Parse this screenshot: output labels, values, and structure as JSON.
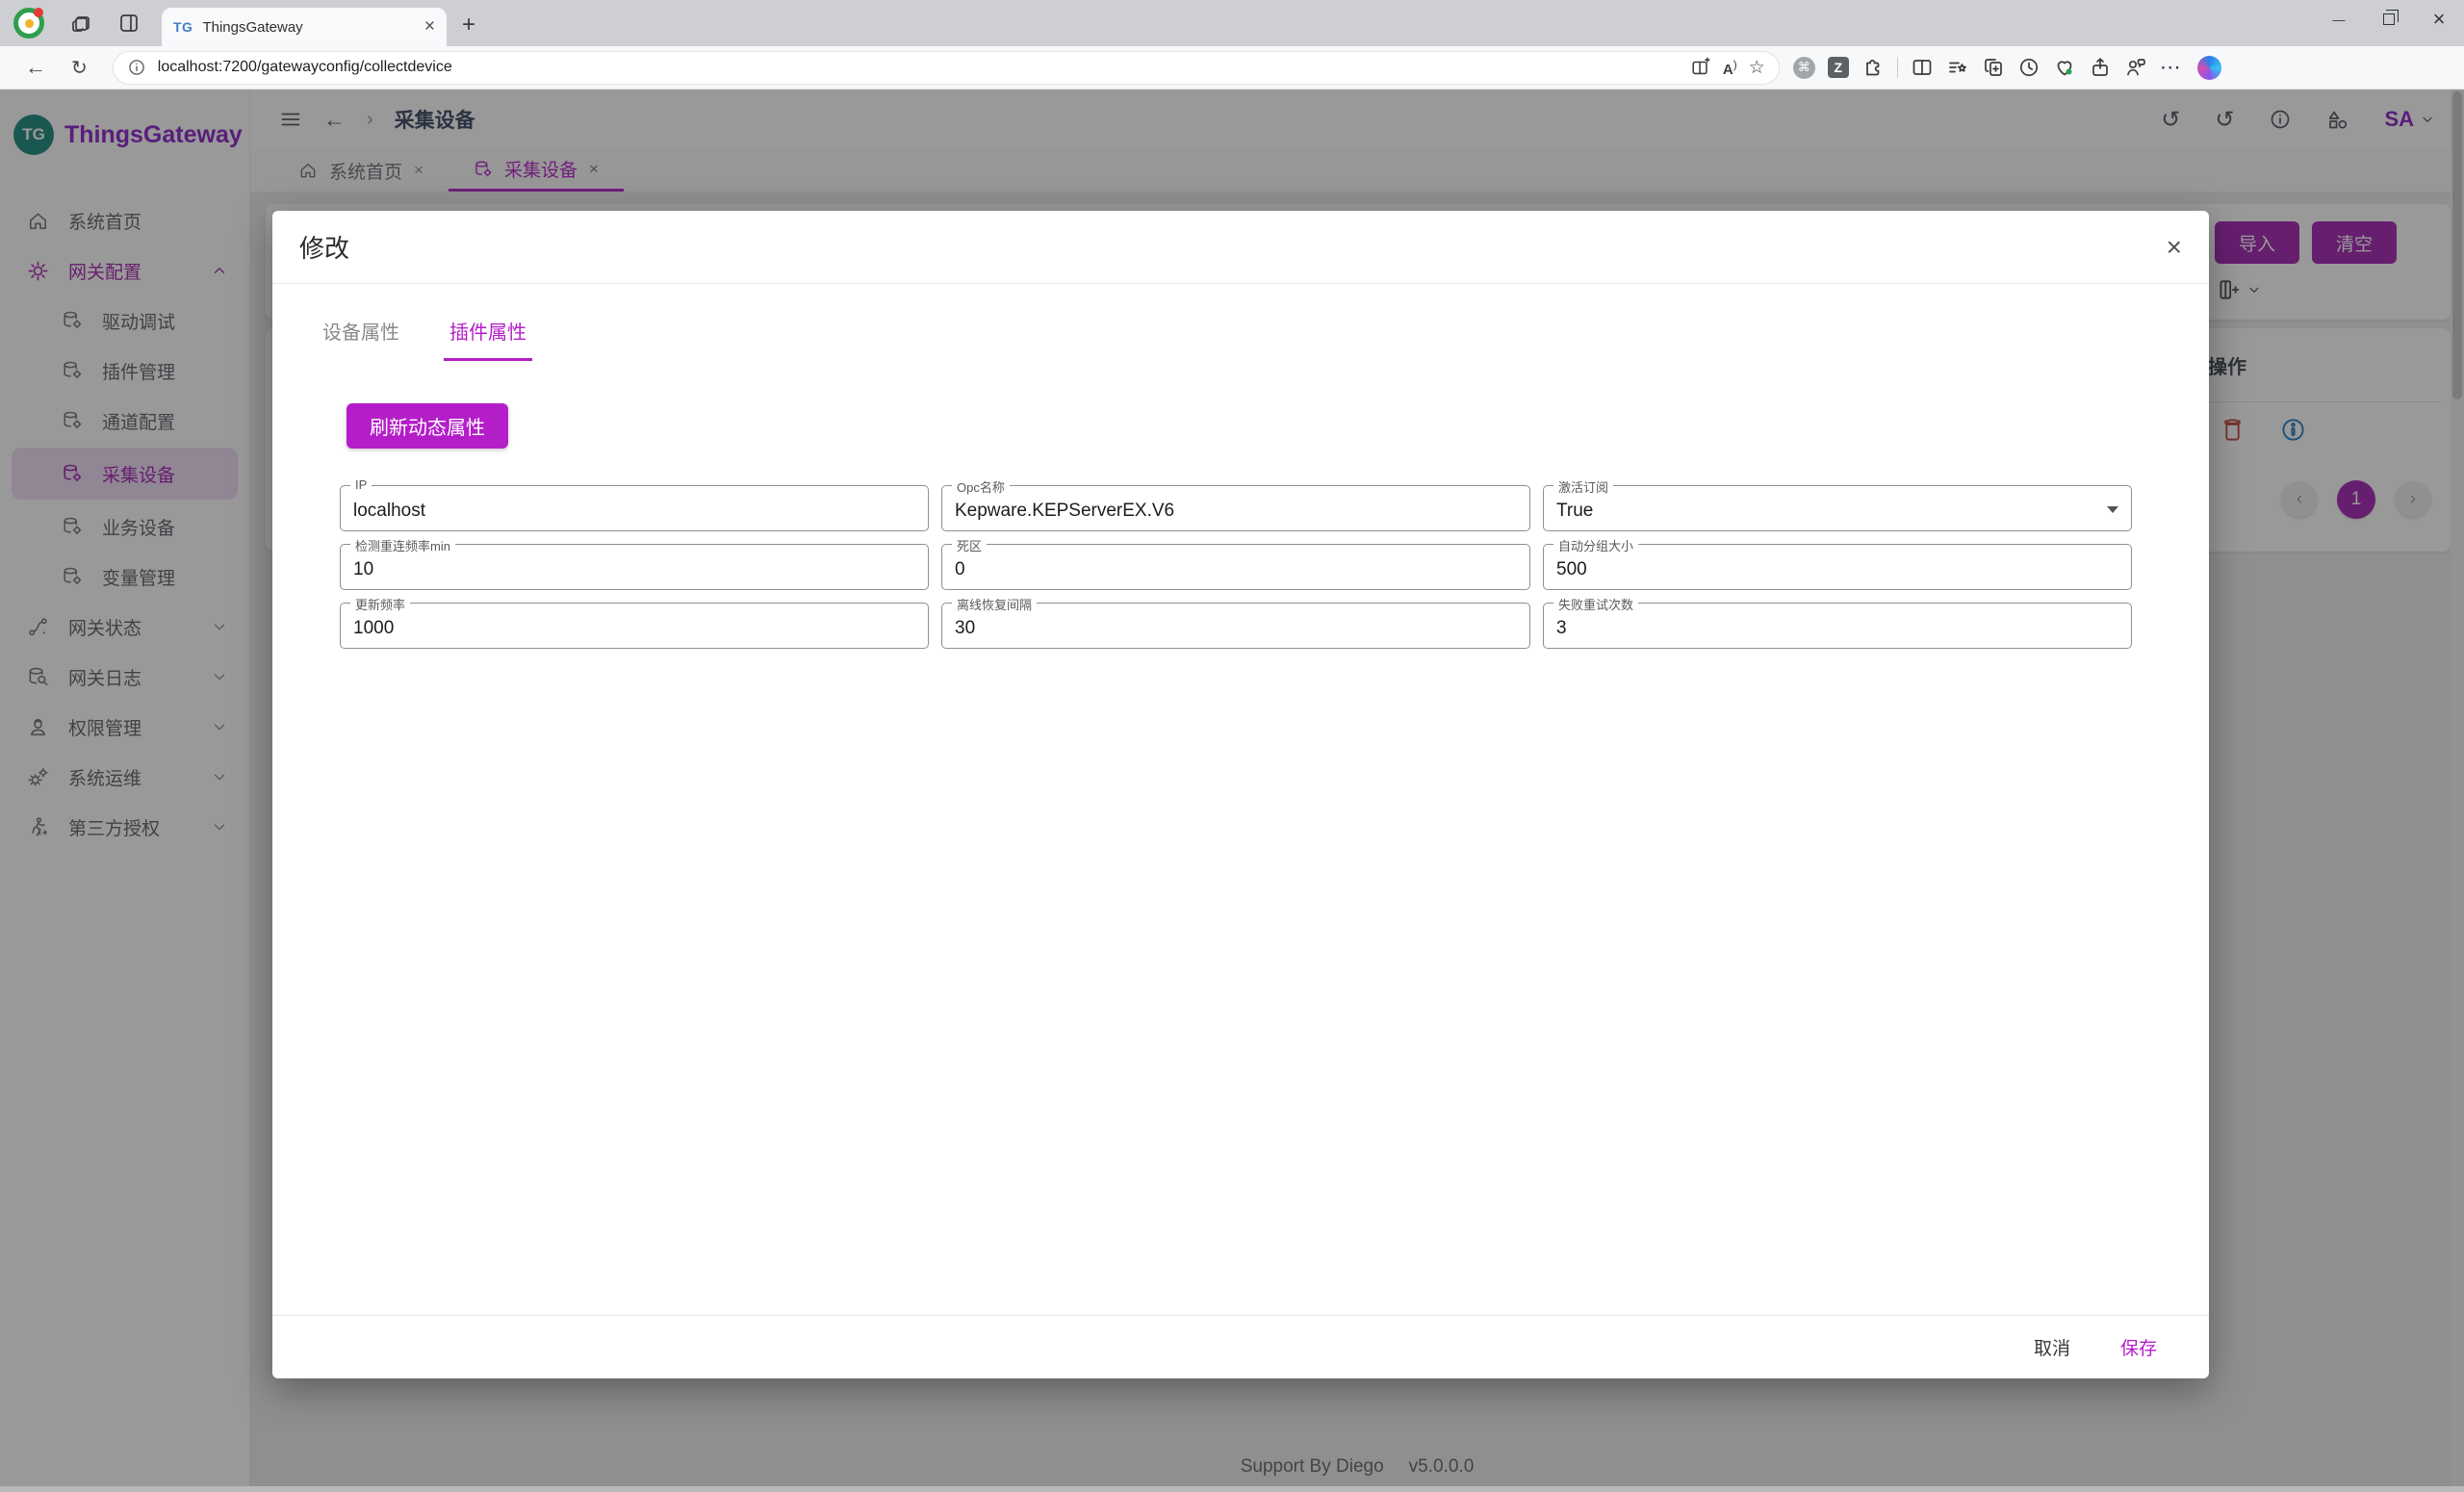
{
  "browser": {
    "tab_title": "ThingsGateway",
    "tab_favicon": "TG",
    "url": "localhost:7200/gatewayconfig/collectdevice",
    "read_aloud": "A"
  },
  "sidebar": {
    "logo_initials": "TG",
    "logo_text": "ThingsGateway",
    "items": [
      {
        "label": "系统首页"
      },
      {
        "label": "网关配置"
      },
      {
        "label": "驱动调试"
      },
      {
        "label": "插件管理"
      },
      {
        "label": "通道配置"
      },
      {
        "label": "采集设备"
      },
      {
        "label": "业务设备"
      },
      {
        "label": "变量管理"
      },
      {
        "label": "网关状态"
      },
      {
        "label": "网关日志"
      },
      {
        "label": "权限管理"
      },
      {
        "label": "系统运维"
      },
      {
        "label": "第三方授权"
      }
    ]
  },
  "appbar": {
    "breadcrumb": "采集设备",
    "user_initials": "SA"
  },
  "page_tabs": [
    {
      "label": "系统首页"
    },
    {
      "label": "采集设备"
    }
  ],
  "background": {
    "import_button": "导入",
    "clear_button": "清空",
    "operations_header": "操作",
    "pagination_current": "1"
  },
  "modal": {
    "title": "修改",
    "tabs": [
      {
        "label": "设备属性"
      },
      {
        "label": "插件属性"
      }
    ],
    "refresh_button": "刷新动态属性",
    "fields": [
      {
        "label": "IP",
        "value": "localhost"
      },
      {
        "label": "Opc名称",
        "value": "Kepware.KEPServerEX.V6"
      },
      {
        "label": "激活订阅",
        "value": "True",
        "type": "select"
      },
      {
        "label": "检测重连频率min",
        "value": "10"
      },
      {
        "label": "死区",
        "value": "0"
      },
      {
        "label": "自动分组大小",
        "value": "500"
      },
      {
        "label": "更新频率",
        "value": "1000"
      },
      {
        "label": "离线恢复间隔",
        "value": "30"
      },
      {
        "label": "失败重试次数",
        "value": "3"
      }
    ],
    "cancel_button": "取消",
    "save_button": "保存"
  },
  "footer": {
    "support": "Support By Diego",
    "version": "v5.0.0.0"
  },
  "colors": {
    "accent": "#b41ec8",
    "sidebar_active": "#a21caf",
    "logo_teal": "#17857b",
    "logo_purple": "#8a1cc9",
    "edit_blue": "#1d71c4",
    "delete_red": "#bf4540",
    "info_blue": "#1b79c0"
  }
}
